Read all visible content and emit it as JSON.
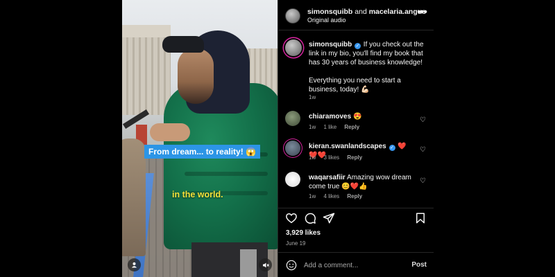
{
  "video": {
    "caption_box": "From dream... to reality! 😱",
    "caption_yellow": "in the world.",
    "icons": [
      "user-tag-icon",
      "mute-icon"
    ]
  },
  "header": {
    "user1": "simonsquibb",
    "and_text": " and ",
    "user2": "macelaria.angus",
    "audio": "Original audio"
  },
  "caption": {
    "user": "simonsquibb",
    "text1": "If you check out the link in my bio, you'll find my book that has 30 years of business knowledge!",
    "text2": "Everything you need to start a business, today! 💪🏻",
    "time": "1w"
  },
  "comments": [
    {
      "user": "chiaramoves",
      "text": "😍",
      "time": "1w",
      "likes": "1 like",
      "reply": "Reply"
    },
    {
      "user": "kieran.swanlandscapes",
      "text": "❤️❤️❤️",
      "time": "1w",
      "likes": "3 likes",
      "reply": "Reply"
    },
    {
      "user": "waqarsafiir",
      "text": "Amazing wow dream come true 😊❤️👍",
      "time": "1w",
      "likes": "4 likes",
      "reply": "Reply"
    }
  ],
  "post": {
    "likes": "3,929 likes",
    "date": "June 19"
  },
  "add_comment": {
    "placeholder": "Add a comment...",
    "post_label": "Post"
  }
}
